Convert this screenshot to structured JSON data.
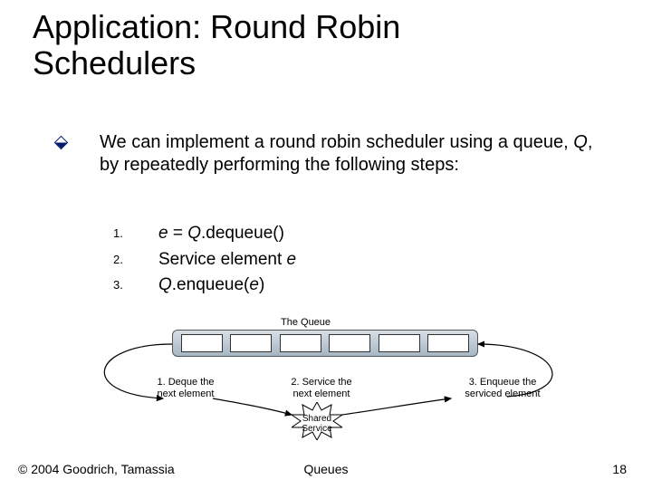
{
  "title": "Application: Round Robin\nSchedulers",
  "intro": {
    "pre": "We can implement a round robin scheduler using a queue, ",
    "q": "Q",
    "post": ", by repeatedly performing the following steps:"
  },
  "steps": {
    "n1": "1.",
    "n2": "2.",
    "n3": "3.",
    "s1": {
      "e": "e",
      "eq": " = ",
      "Q": "Q",
      "rest": ".dequeue()"
    },
    "s2": {
      "pre": "Service element ",
      "e": "e"
    },
    "s3": {
      "Q": "Q",
      "mid": ".enqueue(",
      "e": "e",
      "end": ")"
    }
  },
  "diagram": {
    "queue_label": "The Queue",
    "cap1": "1. Deque the\nnext element",
    "cap2": "2. Service the\nnext element",
    "cap3": "3. Enqueue the\nserviced element",
    "shared": "Shared\nService",
    "cell_count": 6
  },
  "footer": {
    "left": "© 2004 Goodrich, Tamassia",
    "center": "Queues",
    "right": "18"
  }
}
